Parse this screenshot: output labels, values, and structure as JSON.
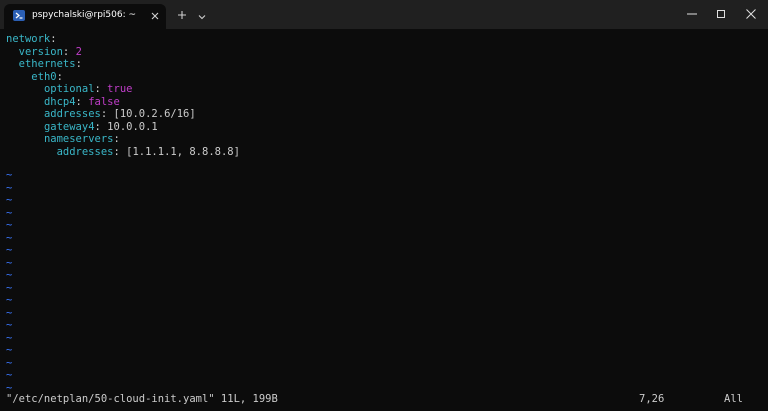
{
  "window": {
    "tab_title": "pspychalski@rpi506: ~",
    "tab_icon": "powershell-icon",
    "new_tab_icon": "plus-icon",
    "dropdown_icon": "chevron-down-icon",
    "minimize_icon": "minimize-icon",
    "maximize_icon": "maximize-icon",
    "close_icon": "close-icon"
  },
  "editor": {
    "lines": [
      {
        "indent": "",
        "key": "network",
        "sep": ":",
        "value": "",
        "value_kind": "none"
      },
      {
        "indent": "  ",
        "key": "version",
        "sep": ": ",
        "value": "2",
        "value_kind": "literal"
      },
      {
        "indent": "  ",
        "key": "ethernets",
        "sep": ":",
        "value": "",
        "value_kind": "none"
      },
      {
        "indent": "    ",
        "key": "eth0",
        "sep": ":",
        "value": "",
        "value_kind": "none"
      },
      {
        "indent": "      ",
        "key": "optional",
        "sep": ": ",
        "value": "true",
        "value_kind": "literal"
      },
      {
        "indent": "      ",
        "key": "dhcp4",
        "sep": ": ",
        "value": "false",
        "value_kind": "literal"
      },
      {
        "indent": "      ",
        "key": "addresses",
        "sep": ": ",
        "value": "[10.0.2.6/16]",
        "value_kind": "text"
      },
      {
        "indent": "      ",
        "key": "gateway4",
        "sep": ": ",
        "value": "10.0.0.1",
        "value_kind": "text"
      },
      {
        "indent": "      ",
        "key": "nameservers",
        "sep": ":",
        "value": "",
        "value_kind": "none"
      },
      {
        "indent": "        ",
        "key": "addresses",
        "sep": ": ",
        "value": "[1.1.1.1, 8.8.8.8]",
        "value_kind": "text"
      }
    ],
    "empty_line_marker": "~",
    "empty_line_count": 18
  },
  "status_line": {
    "file_info": "\"/etc/netplan/50-cloud-init.yaml\" 11L, 199B",
    "cursor_position": "7,26",
    "scroll_position": "All"
  },
  "colors": {
    "background": "#0c0c0c",
    "titlebar": "#202020",
    "key": "#3ab7c8",
    "literal": "#c03ec9",
    "text": "#cccccc",
    "tilde": "#3b78ff"
  }
}
